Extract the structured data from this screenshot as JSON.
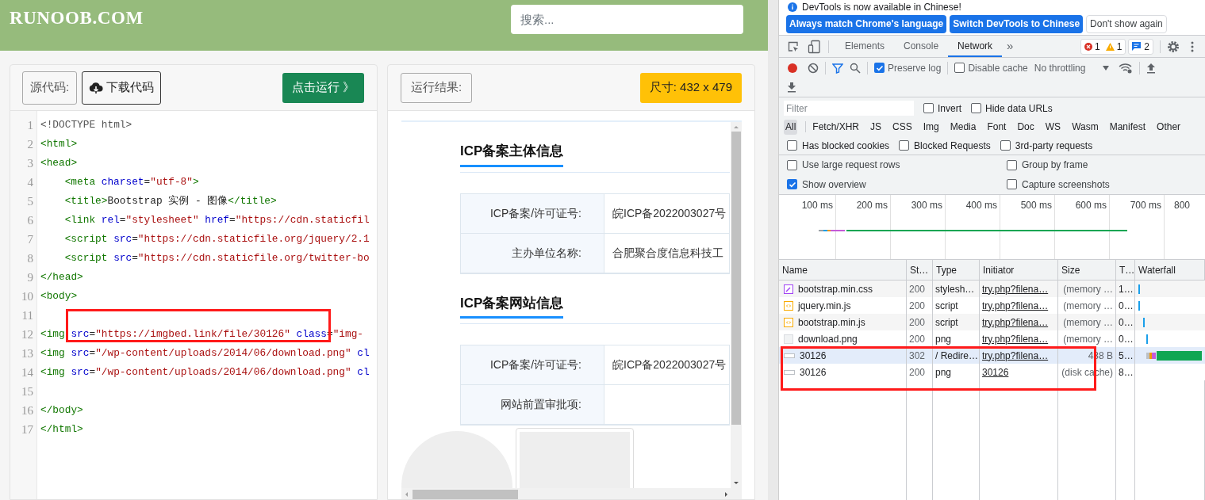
{
  "header": {
    "logo": "RUNOOB.COM",
    "search": {
      "placeholder": "搜索..."
    }
  },
  "editor": {
    "source_label": "源代码:",
    "download_button": "下载代码",
    "run_button": "点击运行 》",
    "lines": [
      {
        "number": "1",
        "tokens": [
          {
            "kind": "meta",
            "text": "<!DOCTYPE html>"
          }
        ]
      },
      {
        "number": "2",
        "tokens": [
          {
            "kind": "tag",
            "text": "<html>"
          }
        ]
      },
      {
        "number": "3",
        "tokens": [
          {
            "kind": "tag",
            "text": "<head>"
          }
        ]
      },
      {
        "number": "4",
        "indented": true,
        "tokens": [
          {
            "kind": "tag",
            "text": "<meta"
          },
          {
            "kind": "attr",
            "text": "charset",
            "space": true
          },
          {
            "kind": "plain",
            "text": "="
          },
          {
            "kind": "string",
            "text": "\"utf-8\""
          },
          {
            "kind": "tag",
            "text": ">"
          }
        ]
      },
      {
        "number": "5",
        "indented": true,
        "tokens": [
          {
            "kind": "tag",
            "text": "<title>"
          },
          {
            "kind": "plain",
            "text": "Bootstrap 实例 - 图像"
          },
          {
            "kind": "tag",
            "text": "</title>"
          }
        ]
      },
      {
        "number": "6",
        "indented": true,
        "tokens": [
          {
            "kind": "tag",
            "text": "<link"
          },
          {
            "kind": "attr",
            "text": "rel",
            "space": true
          },
          {
            "kind": "plain",
            "text": "="
          },
          {
            "kind": "string",
            "text": "\"stylesheet\""
          },
          {
            "kind": "attr",
            "text": "href",
            "space": true
          },
          {
            "kind": "plain",
            "text": "="
          },
          {
            "kind": "string",
            "text": "\"https://cdn.staticfil"
          }
        ]
      },
      {
        "number": "7",
        "indented": true,
        "tokens": [
          {
            "kind": "tag",
            "text": "<script"
          },
          {
            "kind": "attr",
            "text": "src",
            "space": true
          },
          {
            "kind": "plain",
            "text": "="
          },
          {
            "kind": "string",
            "text": "\"https://cdn.staticfile.org/jquery/2.1"
          }
        ]
      },
      {
        "number": "8",
        "indented": true,
        "tokens": [
          {
            "kind": "tag",
            "text": "<script"
          },
          {
            "kind": "attr",
            "text": "src",
            "space": true
          },
          {
            "kind": "plain",
            "text": "="
          },
          {
            "kind": "string",
            "text": "\"https://cdn.staticfile.org/twitter-bo"
          }
        ]
      },
      {
        "number": "9",
        "tokens": [
          {
            "kind": "tag",
            "text": "</head>"
          }
        ]
      },
      {
        "number": "10",
        "tokens": [
          {
            "kind": "tag",
            "text": "<body>"
          }
        ]
      },
      {
        "number": "11"
      },
      {
        "number": "12",
        "tokens": [
          {
            "kind": "tag",
            "text": "<img"
          },
          {
            "kind": "attr",
            "text": "src",
            "space": true
          },
          {
            "kind": "plain",
            "text": "="
          },
          {
            "kind": "string",
            "text": "\"https://imgbed.link/file/30126\""
          },
          {
            "kind": "attr",
            "text": "class",
            "space": true
          },
          {
            "kind": "plain",
            "text": "="
          },
          {
            "kind": "string",
            "text": "\"img-"
          }
        ],
        "highlighted": true
      },
      {
        "number": "13",
        "tokens": [
          {
            "kind": "tag",
            "text": "<img"
          },
          {
            "kind": "attr",
            "text": "src",
            "space": true
          },
          {
            "kind": "plain",
            "text": "="
          },
          {
            "kind": "string",
            "text": "\"/wp-content/uploads/2014/06/download.png\""
          },
          {
            "kind": "attr",
            "text": "cl",
            "space": true
          }
        ]
      },
      {
        "number": "14",
        "tokens": [
          {
            "kind": "tag",
            "text": "<img"
          },
          {
            "kind": "attr",
            "text": "src",
            "space": true
          },
          {
            "kind": "plain",
            "text": "="
          },
          {
            "kind": "string",
            "text": "\"/wp-content/uploads/2014/06/download.png\""
          },
          {
            "kind": "attr",
            "text": "cl",
            "space": true
          }
        ]
      },
      {
        "number": "15"
      },
      {
        "number": "16",
        "tokens": [
          {
            "kind": "tag",
            "text": "</body>"
          }
        ]
      },
      {
        "number": "17",
        "tokens": [
          {
            "kind": "tag",
            "text": "</html>"
          }
        ]
      }
    ]
  },
  "result": {
    "label": "运行结果:",
    "size_badge": "尺寸: 432 x 479",
    "sections": [
      {
        "title": "ICP备案主体信息",
        "rows": [
          {
            "label": "ICP备案/许可证号:",
            "value": "皖ICP备2022003027号"
          },
          {
            "label": "主办单位名称:",
            "value": "合肥聚合度信息科技工"
          }
        ]
      },
      {
        "title": "ICP备案网站信息",
        "rows": [
          {
            "label": "ICP备案/许可证号:",
            "value": "皖ICP备2022003027号"
          },
          {
            "label": "网站前置审批项:"
          }
        ]
      }
    ]
  },
  "devtools": {
    "notice": "DevTools is now available in Chinese!",
    "notice_buttons": [
      {
        "label": "Always match Chrome's language",
        "kind": "primary"
      },
      {
        "label": "Switch DevTools to Chinese",
        "kind": "primary"
      },
      {
        "label": "Don't show again",
        "kind": "secondary"
      }
    ],
    "tabs": [
      {
        "label": "Elements",
        "selected": false
      },
      {
        "label": "Console",
        "selected": false
      },
      {
        "label": "Network",
        "selected": true
      }
    ],
    "more": "»",
    "counts": {
      "errors": "1",
      "warnings": "1",
      "messages": "2"
    },
    "toolbar": {
      "recording": true,
      "preserve_log": {
        "label": "Preserve log",
        "checked": true
      },
      "disable_cache": {
        "label": "Disable cache",
        "checked": false
      },
      "throttling": "No throttling"
    },
    "filter": {
      "placeholder": "Filter",
      "options": [
        {
          "label": "Invert",
          "checked": false
        },
        {
          "label": "Hide data URLs",
          "checked": false
        }
      ]
    },
    "types": [
      {
        "label": "All",
        "selected": true
      },
      {
        "label": "Fetch/XHR",
        "selected": false
      },
      {
        "label": "JS",
        "selected": false
      },
      {
        "label": "CSS",
        "selected": false
      },
      {
        "label": "Img",
        "selected": false
      },
      {
        "label": "Media",
        "selected": false
      },
      {
        "label": "Font",
        "selected": false
      },
      {
        "label": "Doc",
        "selected": false
      },
      {
        "label": "WS",
        "selected": false
      },
      {
        "label": "Wasm",
        "selected": false
      },
      {
        "label": "Manifest",
        "selected": false
      },
      {
        "label": "Other",
        "selected": false
      }
    ],
    "options": [
      {
        "label": "Has blocked cookies",
        "checked": false
      },
      {
        "label": "Blocked Requests",
        "checked": false
      },
      {
        "label": "3rd-party requests",
        "checked": false
      }
    ],
    "settings": [
      {
        "label": "Use large request rows",
        "checked": false
      },
      {
        "label": "Group by frame",
        "checked": false
      },
      {
        "label": "Show overview",
        "checked": true
      },
      {
        "label": "Capture screenshots",
        "checked": false
      }
    ],
    "overview_ticks": [
      "100 ms",
      "200 ms",
      "300 ms",
      "400 ms",
      "500 ms",
      "600 ms",
      "700 ms",
      "800"
    ],
    "columns": [
      "Name",
      "St…",
      "Type",
      "Initiator",
      "Size",
      "T…",
      "Waterfall"
    ],
    "requests": [
      {
        "kind": "css",
        "name": "bootstrap.min.css",
        "status": "200",
        "type": "stylesh…",
        "initiator": "try.php?filena…",
        "size": "(memory …",
        "time": "1…",
        "selected": false,
        "highlighted": false
      },
      {
        "kind": "js",
        "name": "jquery.min.js",
        "status": "200",
        "type": "script",
        "initiator": "try.php?filena…",
        "size": "(memory …",
        "time": "0…",
        "selected": false,
        "highlighted": false
      },
      {
        "kind": "js",
        "name": "bootstrap.min.js",
        "status": "200",
        "type": "script",
        "initiator": "try.php?filena…",
        "size": "(memory …",
        "time": "0…",
        "selected": false,
        "highlighted": false
      },
      {
        "kind": "image",
        "name": "download.png",
        "status": "200",
        "type": "png",
        "initiator": "try.php?filena…",
        "size": "(memory …",
        "time": "0…",
        "selected": false,
        "highlighted": false
      },
      {
        "kind": "other",
        "name": "30126",
        "status": "302",
        "type": "/ Redire…",
        "initiator": "try.php?filena…",
        "size": "438 B",
        "time": "5…",
        "selected": true,
        "highlighted": true
      },
      {
        "kind": "other",
        "name": "30126",
        "status": "200",
        "type": "png",
        "initiator": "30126",
        "size": "(disk cache)",
        "time": "8…",
        "selected": false,
        "highlighted": true
      }
    ]
  }
}
